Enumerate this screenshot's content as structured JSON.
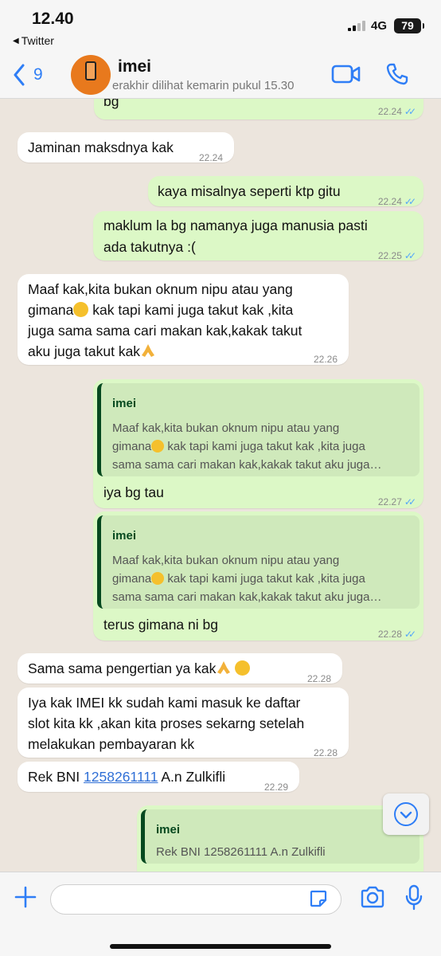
{
  "status_bar": {
    "time": "12.40",
    "back_app": "Twitter",
    "network": "4G",
    "battery": "79"
  },
  "header": {
    "back_count": "9",
    "contact_name": "imei",
    "last_seen": "erakhir dilihat kemarin pukul 15.30",
    "avatar_icon": "store-logo-icon",
    "video_icon": "video-call-icon",
    "call_icon": "phone-icon"
  },
  "messages": [
    {
      "dir": "out",
      "lines": [
        "bg"
      ],
      "time": "22.24",
      "read": true
    },
    {
      "dir": "in",
      "lines": [
        "Jaminan maksdnya kak"
      ],
      "time": "22.24"
    },
    {
      "dir": "out",
      "lines": [
        "kaya misalnya seperti ktp gitu"
      ],
      "time": "22.24",
      "read": true
    },
    {
      "dir": "out",
      "lines": [
        "maklum la bg namanya juga manusia pasti",
        "ada takutnya :("
      ],
      "time": "22.25",
      "read": true
    },
    {
      "dir": "in",
      "lines": [
        "Maaf kak,kita bukan oknum nipu atau yang",
        "gimana",
        "kak tapi kami juga takut kak ,kita",
        "juga sama sama cari makan kak,kakak takut",
        "aku juga takut kak"
      ],
      "time": "22.26"
    },
    {
      "dir": "out",
      "quote_name": "imei",
      "quote_lines": [
        "Maaf kak,kita bukan oknum nipu atau yang",
        "gimana",
        "kak tapi kami juga takut kak ,kita juga",
        "sama sama cari makan kak,kakak takut aku juga…"
      ],
      "lines": [
        "iya bg tau"
      ],
      "time": "22.27",
      "read": true
    },
    {
      "dir": "out",
      "quote_name": "imei",
      "quote_lines": [
        "Maaf kak,kita bukan oknum nipu atau yang",
        "gimana",
        "kak tapi kami juga takut kak ,kita juga",
        "sama sama cari makan kak,kakak takut aku juga…"
      ],
      "lines": [
        "terus gimana ni bg"
      ],
      "time": "22.28",
      "read": true
    },
    {
      "dir": "in",
      "lines": [
        "Sama sama pengertian ya kak"
      ],
      "time": "22.28"
    },
    {
      "dir": "in",
      "lines": [
        "Iya kak IMEI kk sudah kami masuk ke daftar",
        "slot kita kk ,akan kita proses sekarng setelah",
        "melakukan pembayaran kk"
      ],
      "time": "22.28"
    },
    {
      "dir": "in",
      "lines": [
        "Rek BNI",
        "1258261111",
        "A.n Zulkifli"
      ],
      "time": "22.29"
    },
    {
      "dir": "out",
      "quote_name": "imei",
      "quote_lines": [
        "Rek BNI 1258261111 A.n Zulkifli"
      ],
      "lines": [],
      "time": "",
      "read": false
    }
  ],
  "composer": {
    "placeholder": "",
    "value": ""
  },
  "colors": {
    "accent": "#2f7ef6",
    "outgoing_bubble": "#dcf8c6",
    "incoming_bubble": "#ffffff",
    "quote_bar": "#06491f",
    "read_ticks": "#53a6fa",
    "chat_background": "#ece5dd"
  }
}
